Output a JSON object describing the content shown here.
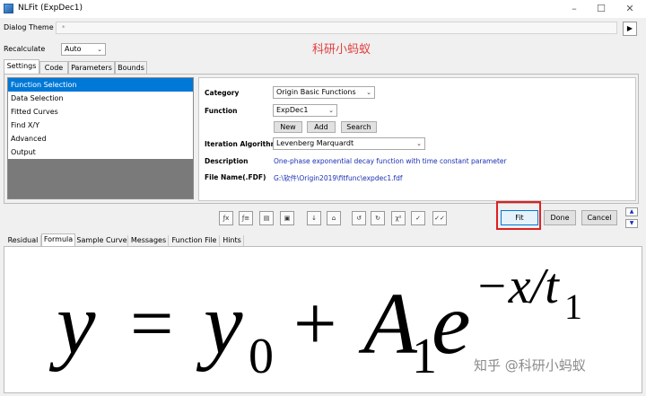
{
  "window": {
    "title": "NLFit (ExpDec1)",
    "minimize": "–",
    "maximize": "☐",
    "close": "✕"
  },
  "dialog_theme": {
    "label": "Dialog Theme",
    "value": "*",
    "arrow": "▶"
  },
  "recalculate": {
    "label": "Recalculate",
    "value": "Auto",
    "chevron": "⌄"
  },
  "watermark_top": "科研小蚂蚁",
  "top_tabs": [
    "Settings",
    "Code",
    "Parameters",
    "Bounds"
  ],
  "left_items": [
    "Function Selection",
    "Data Selection",
    "Fitted Curves",
    "Find X/Y",
    "Advanced",
    "Output"
  ],
  "fields": {
    "category_label": "Category",
    "category_value": "Origin Basic Functions",
    "function_label": "Function",
    "function_value": "ExpDec1",
    "new_btn": "New",
    "add_btn": "Add",
    "search_btn": "Search",
    "iter_label": "Iteration Algorithm",
    "iter_value": "Levenberg Marquardt",
    "desc_label": "Description",
    "desc_value": "One-phase exponential decay function with time constant parameter",
    "file_label": "File Name(.FDF)",
    "file_value": "G:\\软件\\Origin2019\\fitfunc\\expdec1.fdf"
  },
  "buttons": {
    "fit": "Fit",
    "done": "Done",
    "cancel": "Cancel",
    "scroll_up": "▲",
    "scroll_down": "▼"
  },
  "bottom_tabs": [
    "Residual",
    "Formula",
    "Sample Curve",
    "Messages",
    "Function File",
    "Hints"
  ],
  "formula": {
    "y": "y",
    "eq": "=",
    "y0": "y",
    "sub0": "0",
    "plus": "+",
    "A": "A",
    "sub1": "1",
    "e": "e",
    "exp": "−x/t",
    "expsub": "1"
  },
  "watermark_bottom": "知乎 @科研小蚂蚁",
  "colors": {
    "selection": "#0078d7",
    "link_text": "#1a2fb5",
    "highlight": "#e02020",
    "watermark": "#e04040"
  }
}
